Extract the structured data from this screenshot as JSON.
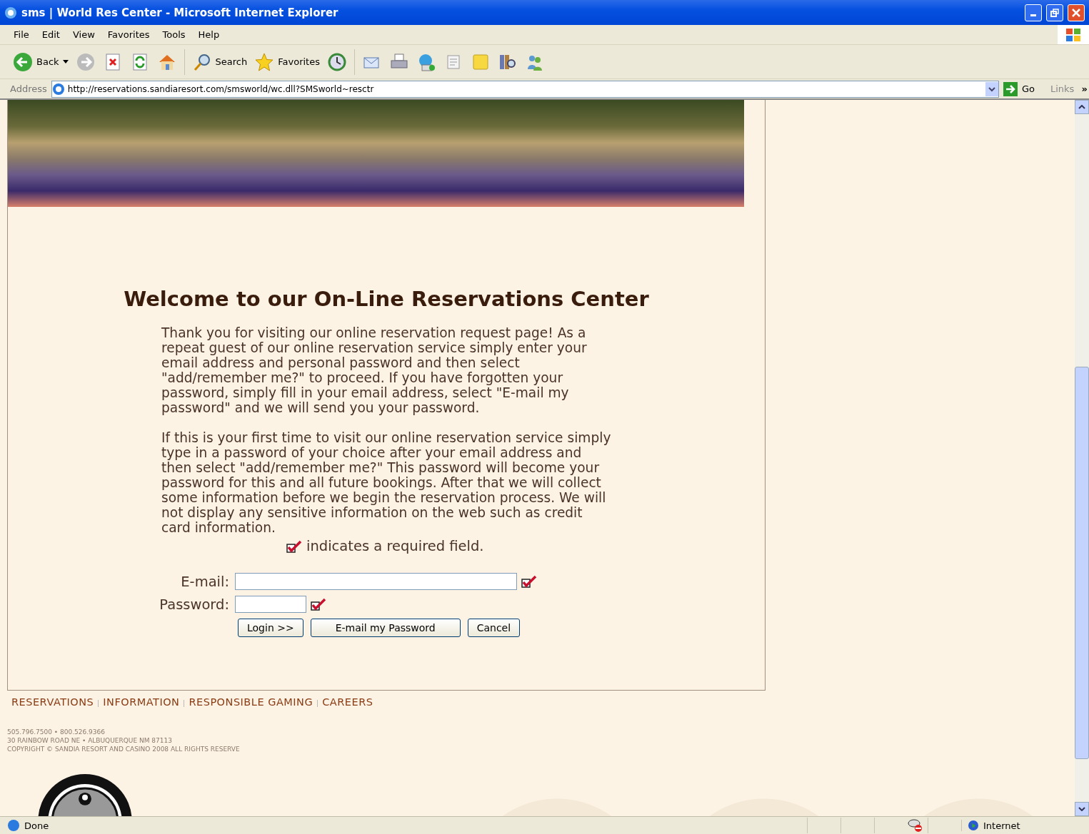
{
  "window": {
    "title": "sms | World Res Center - Microsoft Internet Explorer"
  },
  "menu": [
    "File",
    "Edit",
    "View",
    "Favorites",
    "Tools",
    "Help"
  ],
  "toolbar": {
    "back_label": "Back",
    "search_label": "Search",
    "favorites_label": "Favorites"
  },
  "address_bar": {
    "label": "Address",
    "url": "http://reservations.sandiaresort.com/smsworld/wc.dll?SMSworld~resctr",
    "go_label": "Go",
    "links_label": "Links",
    "more": "»"
  },
  "page": {
    "heading": "Welcome to our On-Line Reservations Center",
    "paragraphs": [
      "Thank you for visiting our online reservation request page! As a repeat guest of our online reservation service simply enter your email address and personal password and then select \"add/remember me?\" to proceed. If you have forgotten your password, simply fill in your email address, select \"E-mail my password\" and we will send you your password.",
      "If this is your first time to visit our online reservation service simply type in a password of your choice after your email address and then select \"add/remember me?\" This password will become your password for this and all future bookings. After that we will collect some information before we begin the reservation process. We will not display any sensitive information on the web such as credit card information."
    ],
    "required_note": "indicates a required field.",
    "fields": [
      {
        "label": "E-mail:",
        "kind": "email",
        "required": true
      },
      {
        "label": "Password:",
        "kind": "password",
        "required": true
      }
    ],
    "buttons": [
      "Login >>",
      "E-mail my Password",
      "Cancel"
    ]
  },
  "footer": {
    "links": [
      "RESERVATIONS",
      "INFORMATION",
      "RESPONSIBLE GAMING",
      "CAREERS"
    ],
    "contact": [
      "505.796.7500 • 800.526.9366",
      "30 RAINBOW ROAD NE • ALBUQUERQUE NM 87113",
      "COPYRIGHT © SANDIA RESORT AND CASINO 2008 ALL RIGHTS RESERVE"
    ]
  },
  "status_bar": {
    "status": "Done",
    "zone": "Internet"
  }
}
